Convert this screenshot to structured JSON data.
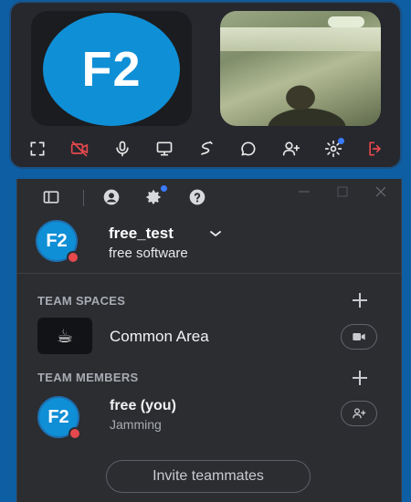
{
  "call": {
    "self_tile": {
      "initials": "F2"
    },
    "toolbar": [
      {
        "icon": "fullscreen-icon"
      },
      {
        "icon": "camera-off-icon",
        "color": "#e5484d"
      },
      {
        "icon": "microphone-icon"
      },
      {
        "icon": "screen-share-icon"
      },
      {
        "icon": "draw-icon"
      },
      {
        "icon": "chat-icon"
      },
      {
        "icon": "add-user-icon"
      },
      {
        "icon": "settings-icon",
        "has_notification": true
      },
      {
        "icon": "leave-call-icon",
        "color": "#e5484d"
      }
    ]
  },
  "panel": {
    "user": {
      "initials": "F2",
      "name": "free_test",
      "team": "free software",
      "status_color": "#e5484d"
    },
    "team_spaces": {
      "heading": "TEAM SPACES",
      "items": [
        {
          "emoji": "☕",
          "name": "Common Area"
        }
      ]
    },
    "team_members": {
      "heading": "TEAM MEMBERS",
      "items": [
        {
          "initials": "F2",
          "name": "free (you)",
          "status": "Jamming"
        }
      ]
    },
    "invite_label": "Invite teammates"
  },
  "colors": {
    "accent": "#0f8fd6",
    "alert": "#e5484d",
    "notification": "#3a7bff",
    "panel_bg": "#2b2d31",
    "desktop_bg": "#0d5ea3"
  }
}
